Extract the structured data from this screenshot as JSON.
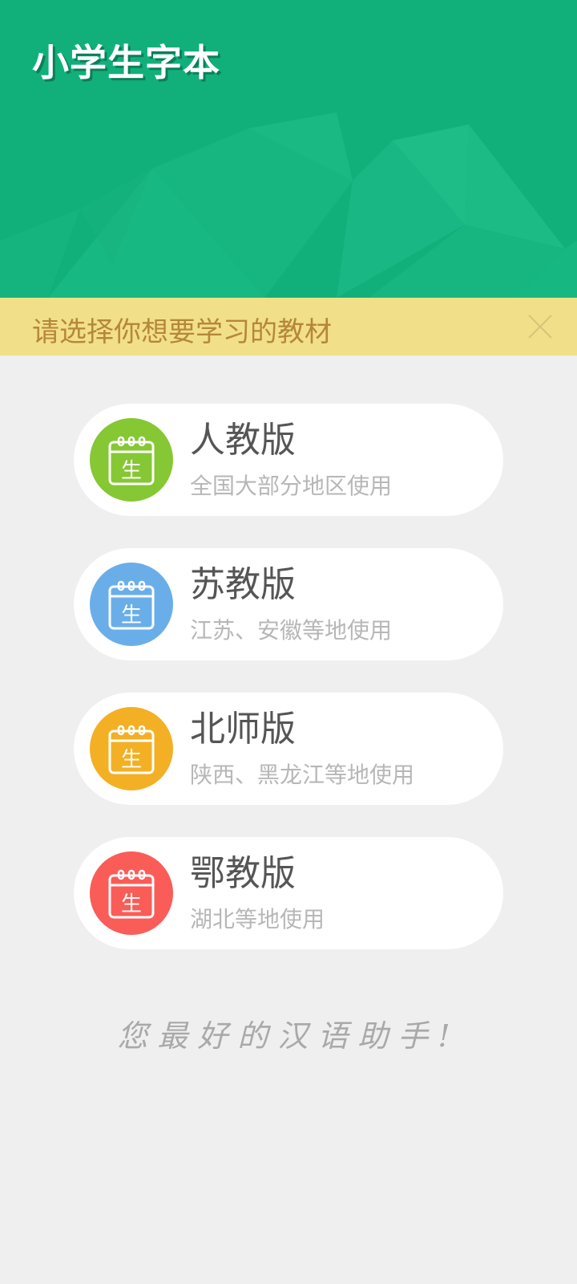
{
  "header": {
    "app_title": "小学生字本"
  },
  "prompt": {
    "text": "请选择你想要学习的教材",
    "close_icon": "close-icon"
  },
  "textbooks": [
    {
      "title": "人教版",
      "subtitle": "全国大部分地区使用",
      "badge_char": "生",
      "color": "#86c734",
      "icon": "calendar-icon"
    },
    {
      "title": "苏教版",
      "subtitle": "江苏、安徽等地使用",
      "badge_char": "生",
      "color": "#6aaee9",
      "icon": "calendar-icon"
    },
    {
      "title": "北师版",
      "subtitle": "陕西、黑龙江等地使用",
      "badge_char": "生",
      "color": "#f3b025",
      "icon": "calendar-icon"
    },
    {
      "title": "鄂教版",
      "subtitle": "湖北等地使用",
      "badge_char": "生",
      "color": "#fa5c58",
      "icon": "calendar-icon"
    }
  ],
  "footer": {
    "tagline": "您最好的汉语助手!"
  },
  "colors": {
    "header_green": "#11b07a",
    "prompt_bg": "#f2df8a",
    "prompt_text": "#b5873a",
    "page_bg": "#efefef"
  }
}
